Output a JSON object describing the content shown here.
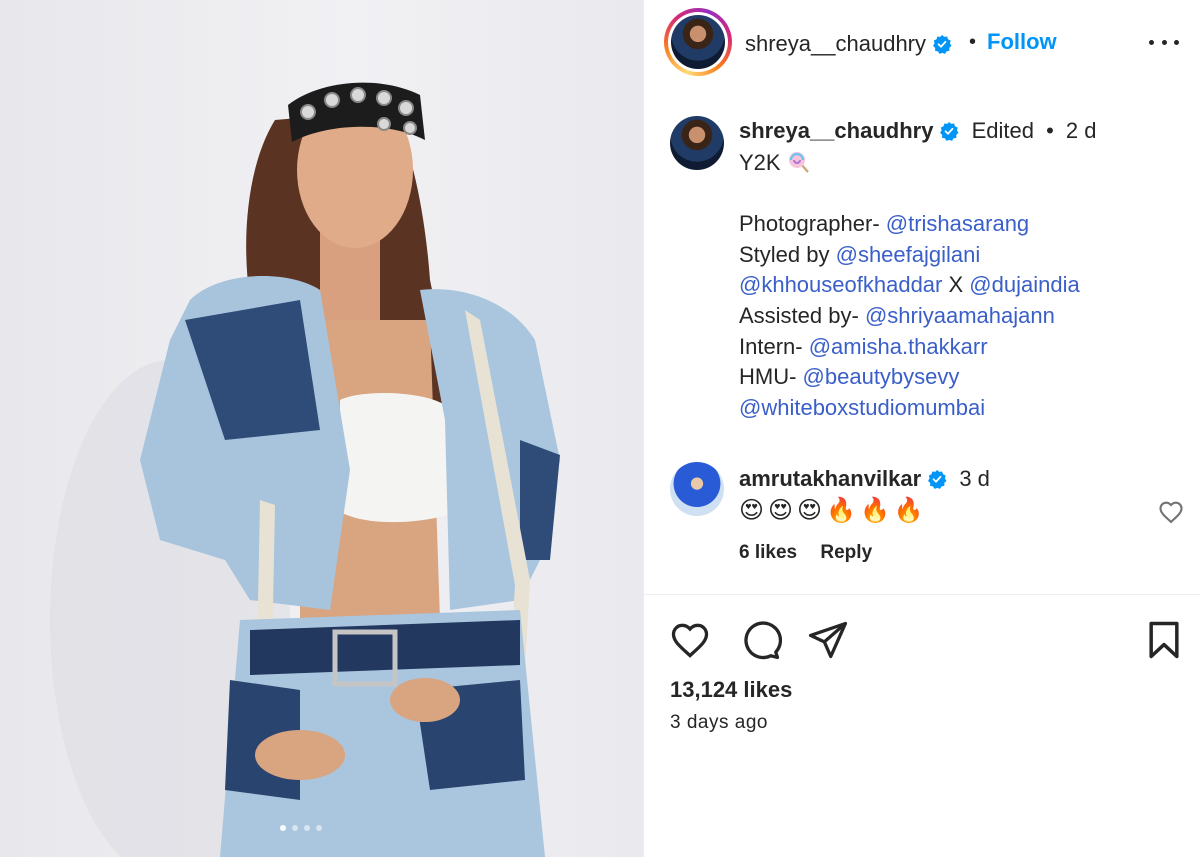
{
  "post": {
    "image_alt": "Woman in distressed denim jacket and skirt with grommet headband",
    "carousel_dots": 4
  },
  "header": {
    "username": "shreya__chaudhry",
    "separator": "•",
    "follow_label": "Follow"
  },
  "caption": {
    "username": "shreya__chaudhry",
    "edited": "Edited",
    "separator": "•",
    "time": "2 d",
    "lines": [
      {
        "text": "Y2K",
        "mention": ""
      },
      {
        "text": "",
        "mention": ""
      },
      {
        "text": "Photographer- ",
        "mention": "@trishasarang"
      },
      {
        "text": "Styled by ",
        "mention": "@sheefajgilani"
      },
      {
        "text": "",
        "mention": "@khhouseofkhaddar",
        "middle": " X ",
        "mention2": "@dujaindia"
      },
      {
        "text": "Assisted by- ",
        "mention": "@shriyaamahajann"
      },
      {
        "text": "Intern- ",
        "mention": "@amisha.thakkarr"
      },
      {
        "text": "HMU- ",
        "mention": "@beautybysevy"
      },
      {
        "text": "",
        "mention": "@whiteboxstudiomumbai"
      }
    ]
  },
  "comment": {
    "username": "amrutakhanvilkar",
    "time": "3 d",
    "text": "😍😍😍🔥🔥🔥",
    "likes": "6 likes",
    "reply": "Reply"
  },
  "engagement": {
    "likes": "13,124 likes",
    "time_ago": "3 days ago"
  },
  "colors": {
    "follow_blue": "#0095f6",
    "mention_blue": "#3a5fc9",
    "verified_blue": "#0095f6"
  }
}
